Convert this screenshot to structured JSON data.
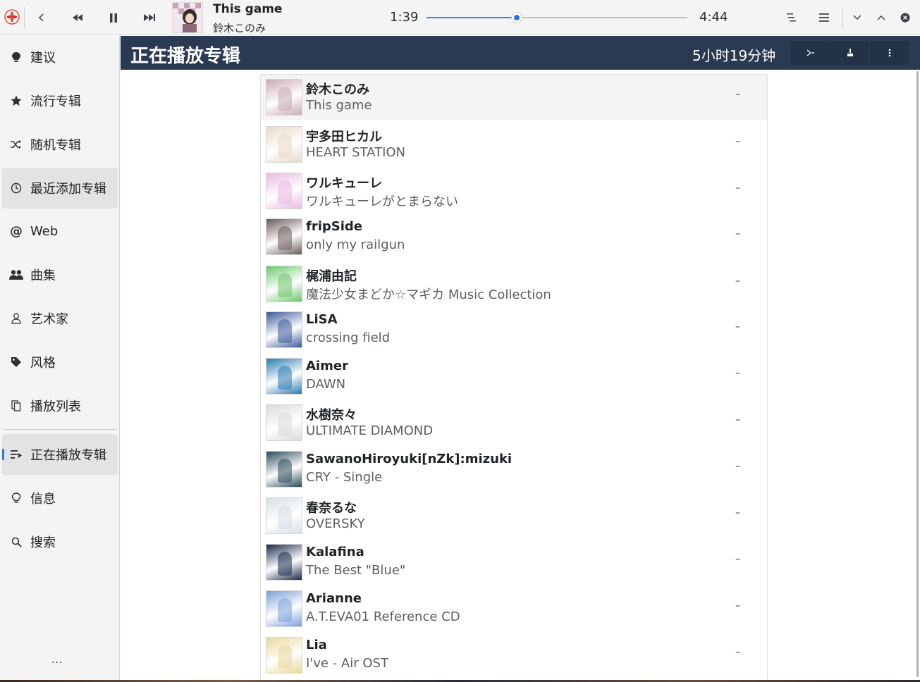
{
  "toolbar": {
    "now_playing_title": "This game",
    "now_playing_artist": "鈴木このみ",
    "position": "1:39",
    "duration": "4:44",
    "progress_fraction": 0.347
  },
  "sidebar": {
    "items": [
      {
        "label": "建议",
        "icon": "lightbulb-tag-icon"
      },
      {
        "label": "流行专辑",
        "icon": "star-icon"
      },
      {
        "label": "随机专辑",
        "icon": "shuffle-icon"
      },
      {
        "label": "最近添加专辑",
        "icon": "clock-icon"
      },
      {
        "label": "Web",
        "icon": "at-icon"
      },
      {
        "label": "曲集",
        "icon": "group-icon"
      },
      {
        "label": "艺术家",
        "icon": "person-icon"
      },
      {
        "label": "风格",
        "icon": "tag-icon"
      },
      {
        "label": "播放列表",
        "icon": "playlist-icon"
      },
      {
        "label": "正在播放专辑",
        "icon": "queue-icon"
      },
      {
        "label": "信息",
        "icon": "bulb-icon"
      },
      {
        "label": "搜索",
        "icon": "search-icon"
      }
    ],
    "more": "..."
  },
  "header": {
    "title": "正在播放专辑",
    "total_duration": "5小时19分钟"
  },
  "albums": [
    {
      "artist": "鈴木このみ",
      "album": "This game",
      "dash": "–",
      "color": "#c9a9b8"
    },
    {
      "artist": "宇多田ヒカル",
      "album": "HEART STATION",
      "dash": "–",
      "color": "#e8d8c8"
    },
    {
      "artist": "ワルキューレ",
      "album": "ワルキューレがとまらない",
      "dash": "–",
      "color": "#e9b8e0"
    },
    {
      "artist": "fripSide",
      "album": "only my railgun",
      "dash": "–",
      "color": "#6a5a5a"
    },
    {
      "artist": "梶浦由記",
      "album": "魔法少女まどか☆マギカ Music Collection",
      "dash": "–",
      "color": "#6cc66a"
    },
    {
      "artist": "LiSA",
      "album": "crossing field",
      "dash": "–",
      "color": "#3a5a9a"
    },
    {
      "artist": "Aimer",
      "album": "DAWN",
      "dash": "–",
      "color": "#2a7ab0"
    },
    {
      "artist": "水樹奈々",
      "album": "ULTIMATE DIAMOND",
      "dash": "–",
      "color": "#d9d9d9"
    },
    {
      "artist": "SawanoHiroyuki[nZk]:mizuki",
      "album": "CRY - Single",
      "dash": "–",
      "color": "#2a4a5a"
    },
    {
      "artist": "春奈るな",
      "album": "OVERSKY",
      "dash": "–",
      "color": "#d6e0e6"
    },
    {
      "artist": "Kalafina",
      "album": "The Best \"Blue\"",
      "dash": "–",
      "color": "#1a2a4a"
    },
    {
      "artist": "Arianne",
      "album": "A.T.EVA01 Reference CD",
      "dash": "–",
      "color": "#7aa0d8"
    },
    {
      "artist": "Lia",
      "album": "I've - Air OST",
      "dash": "–",
      "color": "#e8d89a"
    }
  ]
}
